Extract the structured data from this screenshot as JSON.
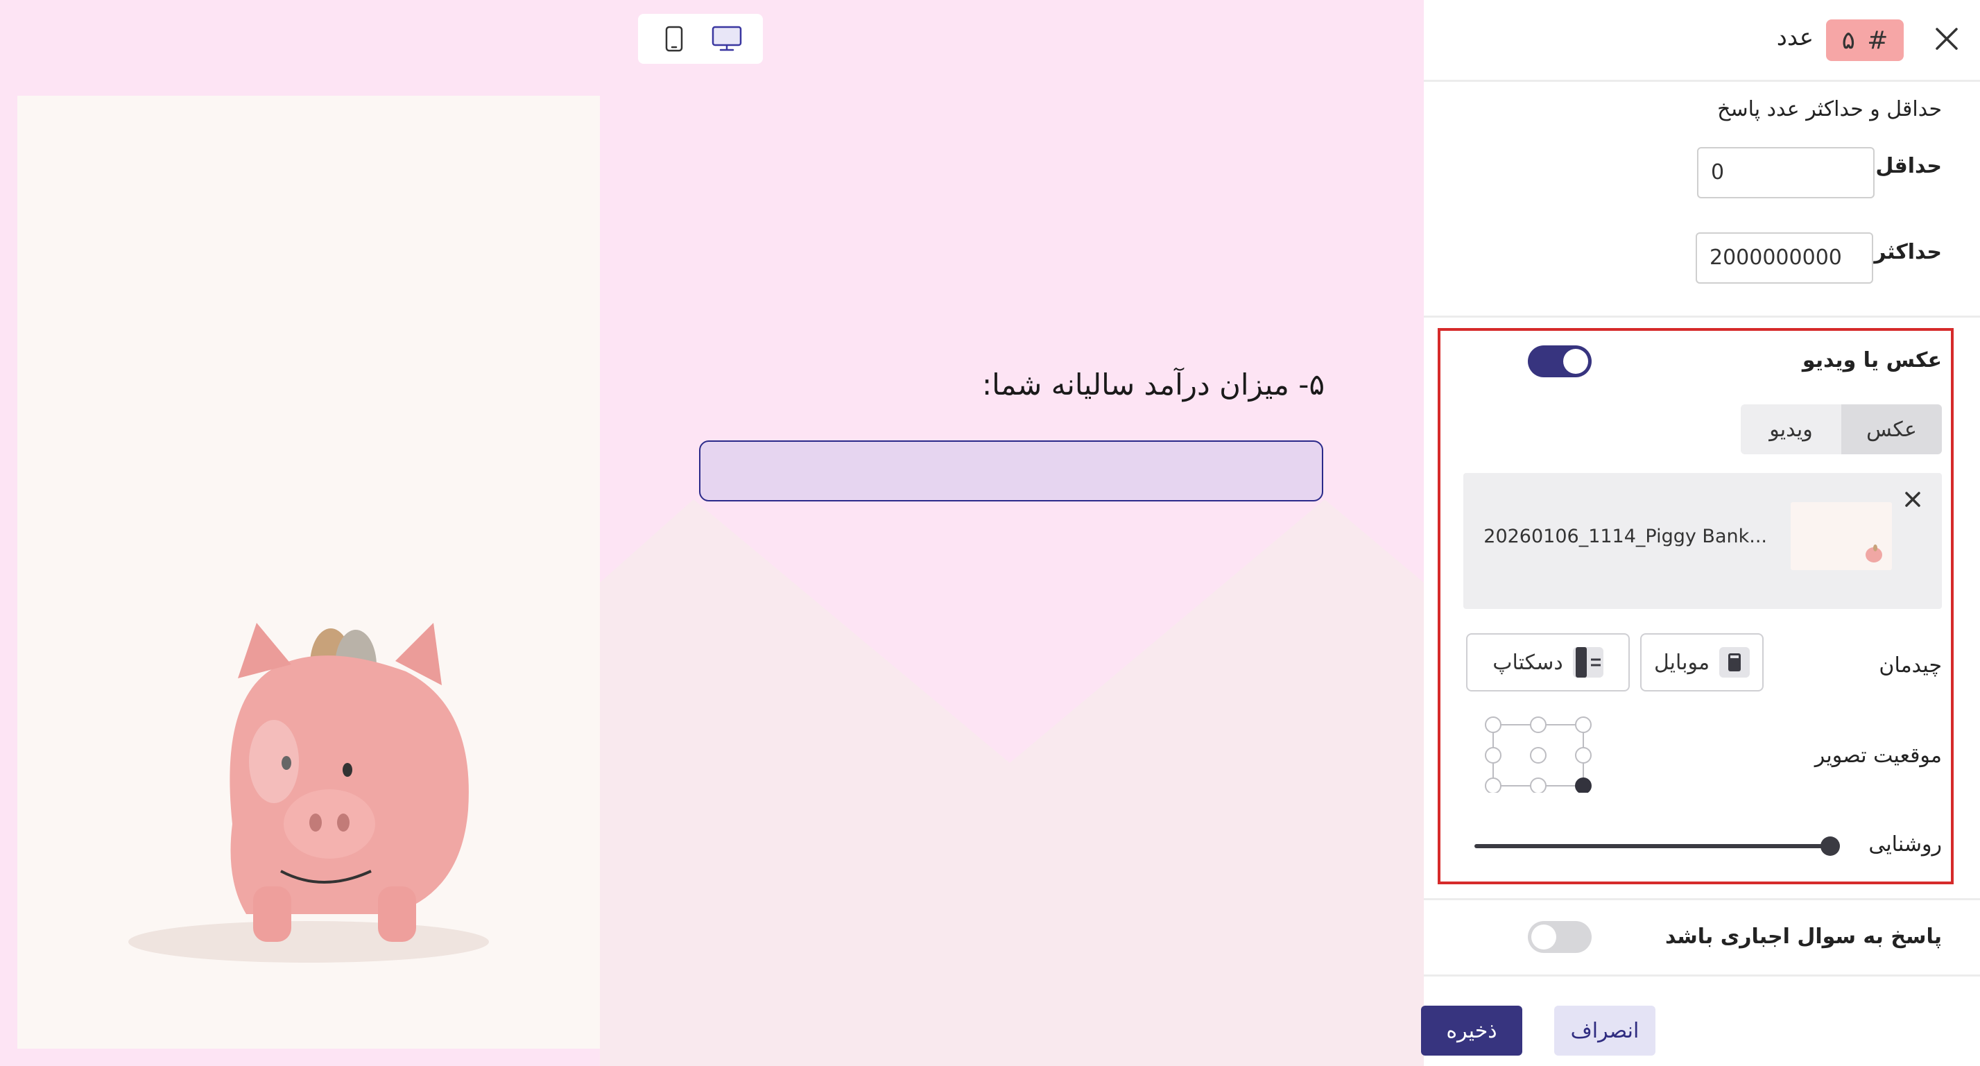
{
  "preview": {
    "question_title": "۵- میزان درآمد سالیانه شما:",
    "device_toggle": {
      "mobile_icon": "smartphone-icon",
      "desktop_icon": "monitor-icon",
      "active": "desktop"
    },
    "answer_input_placeholder": ""
  },
  "sidebar": {
    "header": {
      "close_icon": "close-icon",
      "badge_hash": "#",
      "badge_number": "۵",
      "question_type": "عدد"
    },
    "range": {
      "heading": "حداقل و حداکثر عدد پاسخ",
      "min_label": "حداقل",
      "min_value": "0",
      "max_label": "حداکثر",
      "max_value": "2000000000"
    },
    "media": {
      "title": "عکس یا ویدیو",
      "enabled": true,
      "tabs": [
        "عکس",
        "ویدیو"
      ],
      "active_tab": "عکس",
      "file_name": "20260106_1114_Piggy Bank...",
      "remove_icon": "close-icon",
      "layout_label": "چیدمان",
      "layout_mobile": "موبایل",
      "layout_desktop": "دسکتاپ",
      "position_label": "موقعیت تصویر",
      "position_selected": "bottom-right",
      "brightness_label": "روشنایی",
      "brightness_value": 1.0
    },
    "required": {
      "label": "پاسخ به سوال اجباری باشد",
      "enabled": false
    },
    "footer": {
      "cancel": "انصراف",
      "save": "ذخیره"
    }
  },
  "colors": {
    "preview_bg": "#fde4f4",
    "accent": "#37347f",
    "badge_bg": "#f6a6a6",
    "highlight_border": "#d62b2b",
    "input_fill": "#e6d5f0"
  }
}
